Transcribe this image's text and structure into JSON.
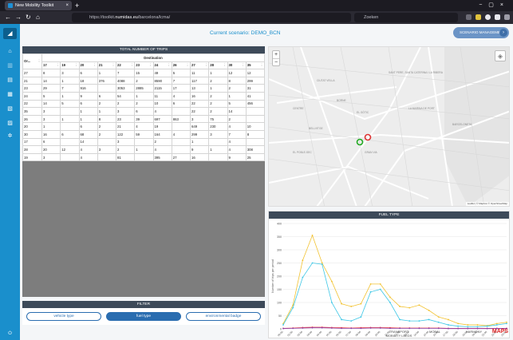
{
  "browser": {
    "tab_title": "New Mobility Toolkit",
    "url_prefix": "https://toolkit.",
    "url_domain": "numidas.eu",
    "url_path": "/barcelona/lcma/",
    "search_placeholder": "Zoeken"
  },
  "header": {
    "scenario_label": "Current scenario: DEMO_BCN",
    "scenario_button": "SCENARIO MANAGEMENT"
  },
  "trips": {
    "title": "TOTAL NUMBER OF TRIPS",
    "origin_header": "Or...",
    "destination_header": "Destination",
    "columns": [
      "17",
      "19",
      "20",
      "21",
      "22",
      "23",
      "24",
      "26",
      "27",
      "28",
      "30",
      "35"
    ],
    "rows": [
      {
        "origin": "27",
        "cells": [
          "8",
          "3",
          "6",
          "1",
          "7",
          "15",
          "49",
          "5",
          "11",
          "1",
          "12",
          "12"
        ]
      },
      {
        "origin": "21",
        "cells": [
          "14",
          "1",
          "18",
          "376",
          "4088",
          "2",
          "8590",
          "7",
          "117",
          "2",
          "8",
          "299"
        ]
      },
      {
        "origin": "23",
        "cells": [
          "29",
          "7",
          "916",
          "",
          "3053",
          "2885",
          "2115",
          "17",
          "13",
          "1",
          "2",
          "31"
        ]
      },
      {
        "origin": "24",
        "cells": [
          "5",
          "1",
          "9",
          "6",
          "54",
          "1",
          "11",
          "4",
          "16",
          "2",
          "1",
          "41"
        ]
      },
      {
        "origin": "22",
        "cells": [
          "14",
          "5",
          "6",
          "2",
          "2",
          "2",
          "10",
          "6",
          "22",
          "2",
          "5",
          "456"
        ]
      },
      {
        "origin": "35",
        "cells": [
          "3",
          "",
          "1",
          "1",
          "3",
          "6",
          "4",
          "",
          "22",
          "2",
          "14",
          ""
        ]
      },
      {
        "origin": "26",
        "cells": [
          "3",
          "1",
          "1",
          "8",
          "23",
          "39",
          "697",
          "863",
          "3",
          "75",
          "2",
          ""
        ]
      },
      {
        "origin": "20",
        "cells": [
          "1",
          "",
          "6",
          "2",
          "21",
          "4",
          "19",
          "",
          "649",
          "230",
          "4",
          "10"
        ]
      },
      {
        "origin": "30",
        "cells": [
          "16",
          "6",
          "68",
          "2",
          "122",
          "59",
          "164",
          "4",
          "299",
          "3",
          "7",
          "8"
        ]
      },
      {
        "origin": "17",
        "cells": [
          "6",
          "",
          "14",
          "",
          "3",
          "",
          "2",
          "",
          "1",
          "",
          "4",
          ""
        ]
      },
      {
        "origin": "28",
        "cells": [
          "20",
          "12",
          "4",
          "3",
          "2",
          "1",
          "4",
          "",
          "9",
          "1",
          "4",
          "308"
        ]
      },
      {
        "origin": "19",
        "cells": [
          "3",
          "",
          "4",
          "",
          "81",
          "",
          "395",
          "27",
          "16",
          "",
          "9",
          "25"
        ]
      }
    ]
  },
  "map": {
    "zoom_in": "+",
    "zoom_out": "−",
    "attribution": "Leaflet | © Mapbox © OpenStreetMap",
    "labels": [
      "CIUTAT VELLA",
      "SANT PERE, SANTA CATERINA I LA RIBERA",
      "CENTRE",
      "EL GÒTIC",
      "BORNE",
      "LA MARINA DE PORT",
      "BARCELONETA",
      "EL POBLE-SEC",
      "GRAN VIA",
      "BELLVITGE"
    ]
  },
  "fuel": {
    "title": "FUEL TYPE",
    "ylabel": "Number of trips per period",
    "yticks": [
      0,
      50,
      100,
      150,
      200,
      250,
      300,
      350,
      400
    ]
  },
  "chart_data": {
    "type": "line",
    "title": "FUEL TYPE",
    "ylabel": "Number of trips per period",
    "xlabel": "",
    "ylim": [
      0,
      400
    ],
    "x": [
      "00:00",
      "01:00",
      "02:00",
      "03:00",
      "04:00",
      "05:00",
      "06:00",
      "07:00",
      "08:00",
      "09:00",
      "10:00",
      "11:00",
      "12:00",
      "13:00",
      "14:00",
      "15:00",
      "16:00",
      "17:00",
      "18:00",
      "19:00",
      "20:00",
      "21:00",
      "22:00",
      "23:00"
    ],
    "series": [
      {
        "color": "#f2c230",
        "values": [
          20,
          90,
          260,
          355,
          250,
          180,
          95,
          85,
          95,
          170,
          170,
          120,
          85,
          80,
          90,
          70,
          45,
          35,
          20,
          15,
          15,
          12,
          20,
          25
        ]
      },
      {
        "color": "#3ec7e6",
        "values": [
          15,
          80,
          195,
          250,
          245,
          100,
          35,
          30,
          45,
          140,
          150,
          100,
          35,
          30,
          30,
          35,
          25,
          15,
          10,
          8,
          8,
          10,
          15,
          20
        ]
      },
      {
        "color": "#ef3e3e",
        "values": [
          2,
          3,
          5,
          6,
          6,
          5,
          4,
          3,
          4,
          5,
          5,
          4,
          3,
          3,
          3,
          3,
          3,
          2,
          2,
          2,
          2,
          2,
          2,
          2
        ]
      },
      {
        "color": "#8e44ad",
        "values": [
          1,
          2,
          3,
          4,
          4,
          3,
          2,
          2,
          2,
          3,
          3,
          2,
          2,
          2,
          2,
          2,
          2,
          1,
          1,
          1,
          1,
          1,
          1,
          1
        ]
      }
    ]
  },
  "filter": {
    "title": "FILTER",
    "buttons": [
      "vehicle type",
      "fuel type",
      "environmental badge"
    ],
    "active": 1
  },
  "logos": [
    "TRANSPORT MOBILITY LEEDS",
    "MOBAL",
    "HARMONY",
    "MAPS"
  ]
}
